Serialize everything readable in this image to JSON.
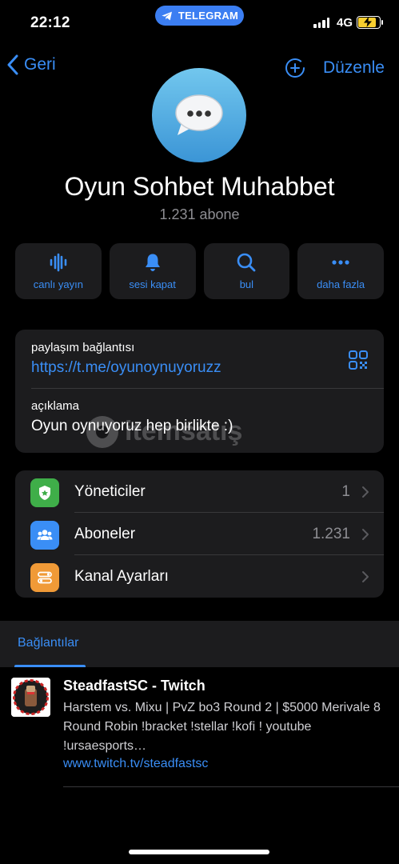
{
  "status": {
    "time": "22:12",
    "network": "4G",
    "app_pill": "TELEGRAM"
  },
  "nav": {
    "back_label": "Geri",
    "edit_label": "Düzenle"
  },
  "channel": {
    "name": "Oyun Sohbet Muhabbet",
    "subscribers": "1.231 abone"
  },
  "actions": [
    {
      "label": "canlı yayın",
      "icon": "live-stream-icon"
    },
    {
      "label": "sesi kapat",
      "icon": "bell-icon"
    },
    {
      "label": "bul",
      "icon": "search-icon"
    },
    {
      "label": "daha fazla",
      "icon": "more-icon"
    }
  ],
  "info": {
    "share_link_label": "paylaşım bağlantısı",
    "share_link": "https://t.me/oyunoynuyoruzz",
    "description_label": "açıklama",
    "description": "Oyun oynuyoruz hep birlikte :)"
  },
  "watermark": {
    "text": "itemsatış"
  },
  "settings": [
    {
      "label": "Yöneticiler",
      "value": "1",
      "icon": "admin-shield-icon",
      "color": "#3fae49"
    },
    {
      "label": "Aboneler",
      "value": "1.231",
      "icon": "subscribers-icon",
      "color": "#3a8ef6"
    },
    {
      "label": "Kanal Ayarları",
      "value": "",
      "icon": "settings-toggle-icon",
      "color": "#f09a37"
    }
  ],
  "tabs": {
    "links": "Bağlantılar"
  },
  "link_preview": {
    "title": "SteadfastSC - Twitch",
    "description": "Harstem vs. Mixu | PvZ bo3 Round 2 | $5000 Merivale 8 Round Robin !bracket !stellar !kofi ! youtube !ursaesports…",
    "url": "www.twitch.tv/steadfastsc"
  },
  "colors": {
    "accent": "#3a8ef6",
    "background": "#000000",
    "card": "#1c1c1e"
  }
}
